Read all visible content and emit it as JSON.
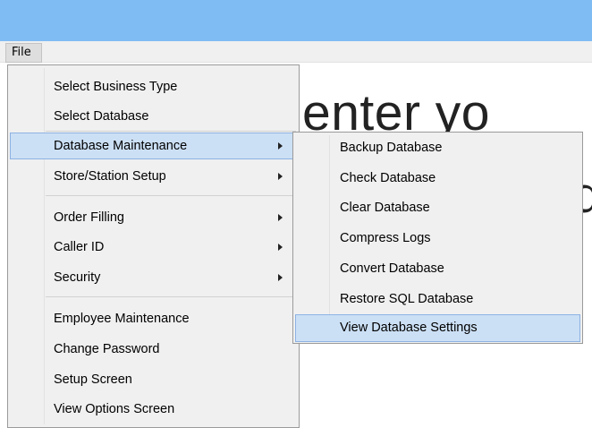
{
  "menubar": {
    "file_label": "File"
  },
  "background_text": {
    "line1": "enter yo",
    "line2": "d"
  },
  "file_menu": {
    "items": [
      {
        "label": "Select Business Type",
        "submenu": false
      },
      {
        "label": "Select Database",
        "submenu": false
      },
      {
        "label": "Database Maintenance",
        "submenu": true,
        "highlighted": true
      },
      {
        "label": "Store/Station Setup",
        "submenu": true
      },
      {
        "label": "Order Filling",
        "submenu": true
      },
      {
        "label": "Caller ID",
        "submenu": true
      },
      {
        "label": "Security",
        "submenu": true
      },
      {
        "label": "Employee Maintenance",
        "submenu": false
      },
      {
        "label": "Change Password",
        "submenu": false
      },
      {
        "label": "Setup Screen",
        "submenu": false
      },
      {
        "label": "View Options Screen",
        "submenu": false
      }
    ]
  },
  "db_maintenance_submenu": {
    "items": [
      {
        "label": "Backup Database"
      },
      {
        "label": "Check Database"
      },
      {
        "label": "Clear Database"
      },
      {
        "label": "Compress Logs"
      },
      {
        "label": "Convert Database"
      },
      {
        "label": "Restore SQL Database"
      },
      {
        "label": "View Database Settings",
        "highlighted": true
      }
    ]
  },
  "colors": {
    "titlebar": "#7fbcf4",
    "menu_bg": "#f0f0f0",
    "highlight_bg": "#cce0f5",
    "highlight_border": "#8db2e3"
  }
}
